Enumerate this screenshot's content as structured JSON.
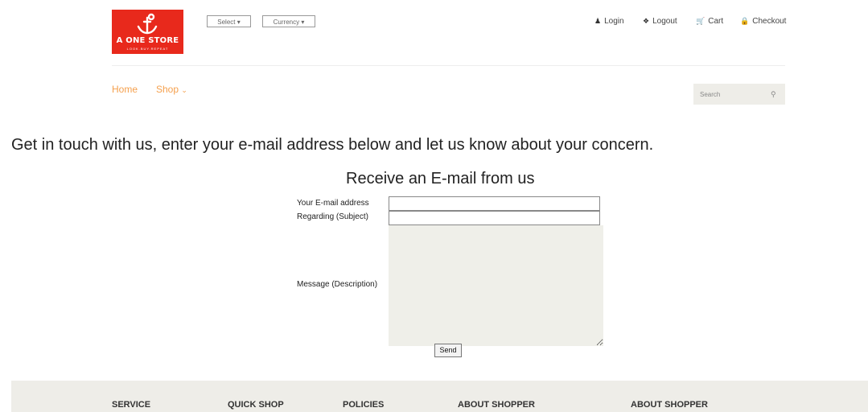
{
  "brand": {
    "name": "A ONE STORE",
    "tagline": "LOOK.BUY.REPEAT",
    "color": "#e8291c"
  },
  "dropdowns": {
    "select": "Select ▾",
    "currency": "Currency ▾"
  },
  "topnav": [
    {
      "icon": "user-icon",
      "label": "Login"
    },
    {
      "icon": "logout-icon",
      "label": "Logout"
    },
    {
      "icon": "cart-icon",
      "label": "Cart"
    },
    {
      "icon": "lock-icon",
      "label": "Checkout"
    }
  ],
  "menu": {
    "home": "Home",
    "shop": "Shop"
  },
  "search": {
    "placeholder": "Search"
  },
  "intro": "Get in touch with us, enter your e-mail address below and let us know about your concern.",
  "form": {
    "title": "Receive an E-mail from us",
    "email_label": "Your E-mail address",
    "subject_label": "Regarding (Subject)",
    "message_label": "Message (Description)",
    "send_label": "Send"
  },
  "footer": {
    "headings": [
      "SERVICE",
      "QUICK SHOP",
      "POLICIES",
      "ABOUT SHOPPER",
      "ABOUT SHOPPER"
    ]
  },
  "colors": {
    "accent": "#f5a04d",
    "panel": "#eeede8"
  }
}
